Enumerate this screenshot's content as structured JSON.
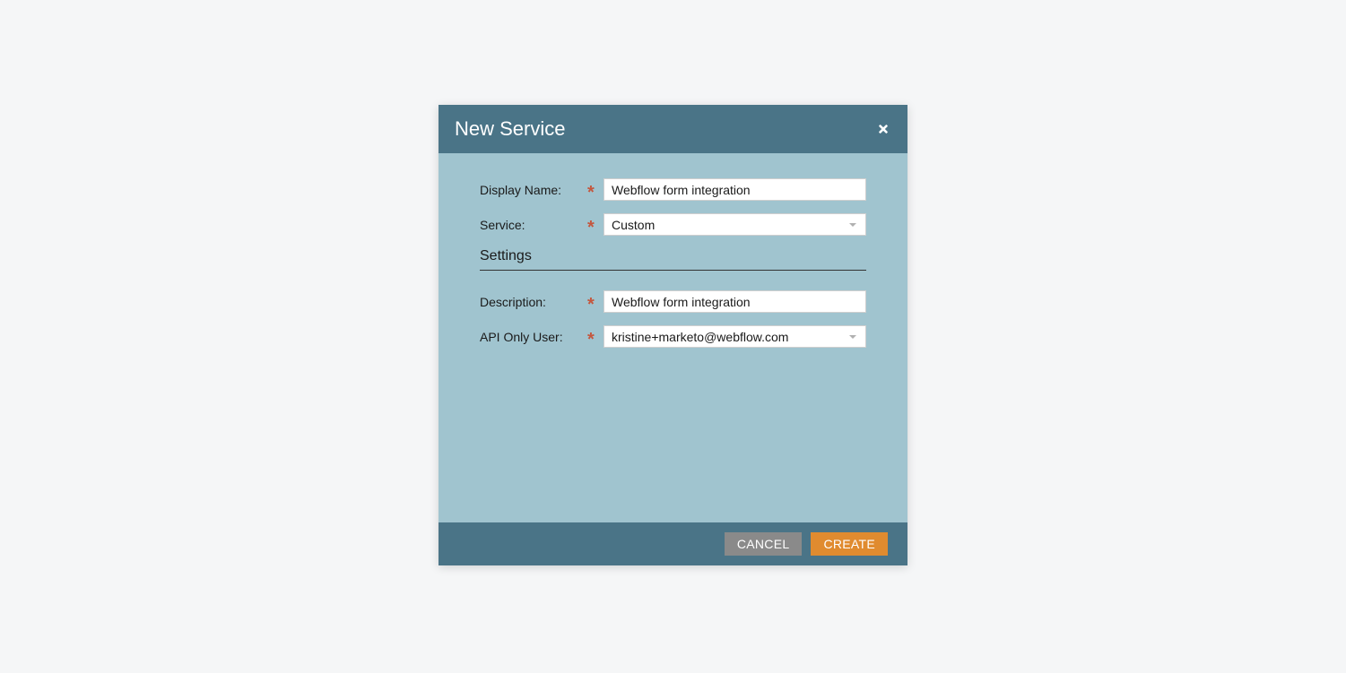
{
  "dialog": {
    "title": "New Service",
    "fields": {
      "display_name": {
        "label": "Display Name:",
        "value": "Webflow form integration"
      },
      "service": {
        "label": "Service:",
        "value": "Custom"
      },
      "description": {
        "label": "Description:",
        "value": "Webflow form integration"
      },
      "api_only_user": {
        "label": "API Only User:",
        "value": "kristine+marketo@webflow.com"
      }
    },
    "section_heading": "Settings",
    "buttons": {
      "cancel": "CANCEL",
      "create": "CREATE"
    }
  }
}
